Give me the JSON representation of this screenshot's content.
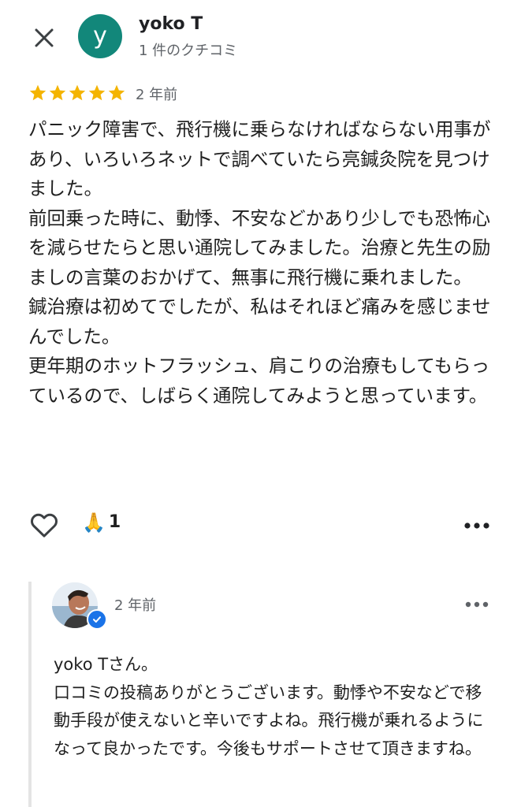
{
  "colors": {
    "avatar_bg": "#12877a",
    "star": "#f4b400",
    "verified": "#1a73e8"
  },
  "header": {
    "close_icon": "close-icon",
    "avatar_letter": "y",
    "user_name": "yoko T",
    "user_meta": "1 件のクチコミ"
  },
  "review": {
    "rating": 5,
    "rating_max": 5,
    "date": "2 年前",
    "paragraphs": [
      "パニック障害で、飛行機に乗らなければならない用事があり、いろいろネットで調べていたら亮鍼灸院を見つけました。",
      "前回乗った時に、動悸、不安などかあり少しでも恐怖心を減らせたらと思い通院してみました。治療と先生の励ましの言葉のおかげて、無事に飛行機に乗れました。",
      "鍼治療は初めてでしたが、私はそれほど痛みを感じませんでした。",
      "更年期のホットフラッシュ、肩こりの治療もしてもらっているので、しばらく通院してみようと思っています。"
    ]
  },
  "actions": {
    "like_icon": "heart-icon",
    "reaction_emoji": "🙏",
    "reaction_count": "1",
    "more_icon": "more-horizontal-icon"
  },
  "reply": {
    "avatar_icon": "owner-avatar",
    "verified_icon": "verified-check-icon",
    "date": "2 年前",
    "paragraphs": [
      "yoko Tさん。",
      "口コミの投稿ありがとうございます。動悸や不安などで移動手段が使えないと辛いですよね。飛行機が乗れるようになって良かったです。今後もサポートさせて頂きますね。"
    ]
  }
}
